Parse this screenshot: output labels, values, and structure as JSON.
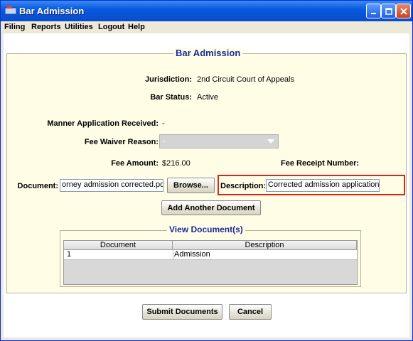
{
  "window": {
    "title": "Bar Admission"
  },
  "menu": [
    "Filing",
    "Reports",
    "Utilities",
    "Logout",
    "Help"
  ],
  "panel": {
    "legend": "Bar Admission",
    "jurisdiction_label": "Jurisdiction:",
    "jurisdiction_value": "2nd Circuit Court of Appeals",
    "bar_status_label": "Bar Status:",
    "bar_status_value": "Active",
    "manner_label": "Manner Application Received:",
    "manner_value": "-",
    "fee_waiver_label": "Fee Waiver Reason:",
    "fee_waiver_value": "-",
    "fee_amount_label": "Fee Amount:",
    "fee_amount_value": "$216.00",
    "fee_receipt_label": "Fee Receipt Number:",
    "document_label": "Document:",
    "document_value": "orney admission corrected.pdf",
    "browse_label": "Browse...",
    "description_label": "Description:",
    "description_value": "Corrected admission application",
    "add_doc_label": "Add Another Document"
  },
  "view_docs": {
    "legend": "View Document(s)",
    "columns": [
      "Document",
      "Description"
    ],
    "rows": [
      {
        "document": "1",
        "description": "Admission"
      }
    ]
  },
  "footer": {
    "submit_label": "Submit Documents",
    "cancel_label": "Cancel"
  },
  "colors": {
    "titlebar": "#0853d6",
    "panel_bg": "#fffde6",
    "legend": "#1a2a9a",
    "highlight": "#d9261c"
  }
}
